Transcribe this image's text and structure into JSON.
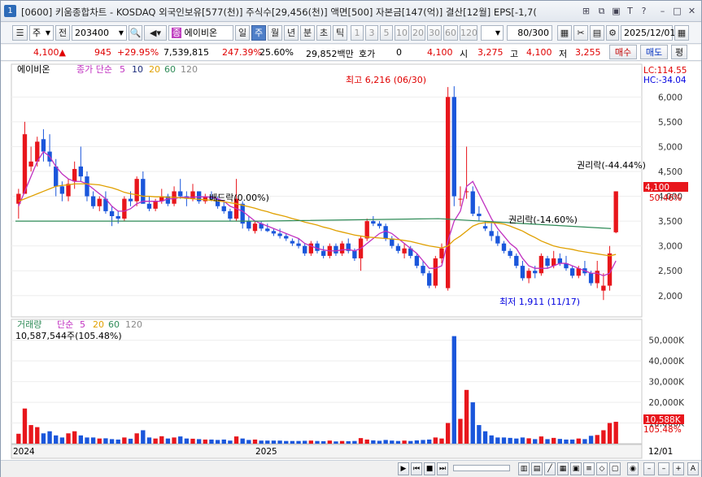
{
  "window": {
    "number": "1",
    "title": "[0600] 키움종합차트 - KOSDAQ 외국인보유[577(천)] 주식수[29,456(천)] 액면[500] 자본금[147(억)] 결산[12월] EPS[-1,7("
  },
  "toolbar": {
    "type_select": "주",
    "prev_label": "전",
    "code": "203400",
    "name_badge": "종",
    "stock_name": "에이비온",
    "periods": [
      "일",
      "주",
      "월",
      "년",
      "분",
      "초",
      "틱"
    ],
    "selected_period": "주",
    "numbers": [
      "1",
      "3",
      "5",
      "10",
      "20",
      "30",
      "60",
      "120"
    ],
    "count": "80/300",
    "date": "2025/12/01"
  },
  "quote": {
    "price": "4,100",
    "change": "945",
    "change_pct": "+29.95%",
    "volume": "7,539,815",
    "vol_ratio": "247.39%",
    "turnover": "25.60%",
    "amount": "29,852백만",
    "hoga_label": "호가",
    "hoga_value": "0",
    "hoga_price": "4,100",
    "open_label": "시",
    "open": "3,275",
    "high_label": "고",
    "high": "4,100",
    "low_label": "저",
    "low": "3,255",
    "sell": "매수",
    "buy": "매도",
    "flat": "평"
  },
  "price_panel": {
    "legend_name": "에이비온",
    "legend_ma_label": "종가 단순",
    "ma_periods": [
      "5",
      "10",
      "20",
      "60",
      "120"
    ],
    "lc": "LC:114.55",
    "hc": "HC:-34.04",
    "current_price": "4,100",
    "current_pct": "50.46%",
    "annotations": {
      "high": "최고 6,216 (06/30)",
      "low": "최저 1,911 (11/17)",
      "dividend": "배드락(0.00%)",
      "rights1": "권리락(-14.60%)",
      "rights2": "권리락(-44.44%)"
    }
  },
  "volume_panel": {
    "legend_name": "거래량",
    "legend_ma_label": "단순",
    "ma_periods": [
      "5",
      "20",
      "60",
      "120"
    ],
    "last_volume": "10,587,544주(105.48%)",
    "current_volume": "10,588K",
    "current_pct": "105.48%"
  },
  "x_labels": [
    "2024",
    "2025",
    "12/01"
  ],
  "colors": {
    "up": "#e8161c",
    "down": "#1a56db",
    "ma5": "#c030c0",
    "ma10": "#1a2a7a",
    "ma20": "#e0a000",
    "ma60": "#2e8b57",
    "ma120": "#888888"
  },
  "icons": [
    "search-icon",
    "speaker-icon",
    "grid-icon",
    "cross-icon",
    "save-icon",
    "gear-icon",
    "calendar-icon",
    "help-icon",
    "close-icon"
  ],
  "chart_data": {
    "type": "candlestick",
    "price_axis": {
      "min": 1800,
      "max": 6300,
      "ticks": [
        2000,
        2500,
        3000,
        3500,
        4000,
        4500,
        5000,
        5500,
        6000
      ]
    },
    "volume_axis": {
      "min": 0,
      "max": 55000,
      "ticks": [
        10000,
        20000,
        30000,
        40000,
        50000
      ],
      "unit": "K"
    },
    "candles": [
      [
        3850,
        4150,
        3550,
        4050,
        4800
      ],
      [
        4050,
        5500,
        4050,
        5250,
        17000
      ],
      [
        4600,
        5000,
        4500,
        4700,
        9000
      ],
      [
        4700,
        5200,
        4600,
        5100,
        8000
      ],
      [
        5150,
        5350,
        4700,
        4900,
        5000
      ],
      [
        4900,
        5250,
        4600,
        4700,
        6000
      ],
      [
        4600,
        4750,
        4000,
        4200,
        4000
      ],
      [
        4200,
        4300,
        3900,
        4050,
        3000
      ],
      [
        4000,
        4350,
        3900,
        4250,
        5000
      ],
      [
        4300,
        4700,
        4150,
        4550,
        6000
      ],
      [
        4600,
        5000,
        4300,
        4400,
        4000
      ],
      [
        4400,
        4500,
        3900,
        4000,
        3000
      ],
      [
        4000,
        4100,
        3750,
        3800,
        3000
      ],
      [
        3800,
        4000,
        3700,
        3950,
        2500
      ],
      [
        3950,
        4100,
        3650,
        3700,
        2600
      ],
      [
        3700,
        3800,
        3400,
        3600,
        2200
      ],
      [
        3600,
        3700,
        3450,
        3550,
        2000
      ],
      [
        3550,
        4000,
        3500,
        3950,
        3000
      ],
      [
        3950,
        4100,
        3800,
        3900,
        2400
      ],
      [
        3900,
        4400,
        3800,
        4350,
        5000
      ],
      [
        4350,
        4500,
        3850,
        3850,
        6500
      ],
      [
        3850,
        4000,
        3700,
        3750,
        3000
      ],
      [
        3750,
        3950,
        3700,
        3900,
        2500
      ],
      [
        3900,
        4150,
        3850,
        4000,
        3600
      ],
      [
        4000,
        4050,
        3800,
        3850,
        2500
      ],
      [
        3850,
        4200,
        3800,
        4100,
        3000
      ],
      [
        4100,
        4350,
        3950,
        4000,
        3500
      ],
      [
        4000,
        4100,
        3800,
        3950,
        2500
      ],
      [
        3950,
        4250,
        3900,
        4100,
        2400
      ],
      [
        4100,
        4100,
        3850,
        3900,
        2200
      ],
      [
        3900,
        4050,
        3850,
        4000,
        2000
      ],
      [
        4000,
        4100,
        3900,
        3950,
        2000
      ],
      [
        3950,
        4000,
        3750,
        3800,
        1800
      ],
      [
        3800,
        3900,
        3650,
        3700,
        2000
      ],
      [
        3700,
        3750,
        3500,
        3550,
        1500
      ],
      [
        3550,
        4350,
        3500,
        3950,
        3500
      ],
      [
        3850,
        3900,
        3350,
        3450,
        2500
      ],
      [
        3500,
        3600,
        3300,
        3350,
        1800
      ],
      [
        3300,
        3500,
        3250,
        3450,
        2000
      ],
      [
        3450,
        3500,
        3300,
        3350,
        1500
      ],
      [
        3350,
        3450,
        3280,
        3300,
        1500
      ],
      [
        3300,
        3350,
        3200,
        3250,
        1500
      ],
      [
        3250,
        3350,
        3150,
        3200,
        1500
      ],
      [
        3200,
        3250,
        3100,
        3150,
        1300
      ],
      [
        3100,
        3150,
        3000,
        3050,
        1300
      ],
      [
        3050,
        3150,
        2950,
        3000,
        1300
      ],
      [
        3000,
        3050,
        2800,
        2850,
        1400
      ],
      [
        2850,
        3100,
        2800,
        3050,
        1500
      ],
      [
        3050,
        3100,
        2850,
        2900,
        1300
      ],
      [
        2900,
        3000,
        2750,
        2800,
        1200
      ],
      [
        2800,
        3050,
        2750,
        3000,
        1500
      ],
      [
        3000,
        3050,
        2800,
        2850,
        1100
      ],
      [
        2850,
        3100,
        2800,
        3050,
        1300
      ],
      [
        3050,
        3150,
        2850,
        2900,
        1200
      ],
      [
        2900,
        2950,
        2700,
        2750,
        1300
      ],
      [
        2750,
        3200,
        2500,
        3150,
        2700
      ],
      [
        3150,
        3550,
        3100,
        3500,
        2000
      ],
      [
        3500,
        3600,
        3400,
        3450,
        1600
      ],
      [
        3450,
        3500,
        3350,
        3400,
        1400
      ],
      [
        3400,
        3450,
        3100,
        3150,
        1800
      ],
      [
        3150,
        3200,
        2950,
        3000,
        1500
      ],
      [
        3000,
        3050,
        2850,
        2900,
        1300
      ],
      [
        2850,
        3050,
        2750,
        2950,
        1500
      ],
      [
        2950,
        3000,
        2750,
        2800,
        1300
      ],
      [
        2800,
        2850,
        2550,
        2600,
        1600
      ],
      [
        2600,
        2700,
        2400,
        2450,
        1800
      ],
      [
        2450,
        2500,
        2150,
        2200,
        2000
      ],
      [
        2200,
        2800,
        2150,
        2750,
        3000
      ],
      [
        2750,
        3050,
        2650,
        2950,
        2500
      ],
      [
        2150,
        6200,
        2100,
        6000,
        10000
      ],
      [
        6000,
        6216,
        3800,
        4000,
        52000
      ],
      [
        3950,
        4200,
        3800,
        3950,
        12000
      ],
      [
        4100,
        5000,
        3950,
        4100,
        26000
      ],
      [
        4100,
        4200,
        3600,
        3650,
        20000
      ],
      [
        3650,
        3800,
        3500,
        3600,
        9000
      ],
      [
        3400,
        3500,
        3300,
        3350,
        6000
      ],
      [
        3300,
        3500,
        3100,
        3200,
        4000
      ],
      [
        3200,
        3300,
        3000,
        3050,
        3000
      ],
      [
        3050,
        3100,
        2850,
        2900,
        3000
      ],
      [
        2900,
        2950,
        2750,
        2800,
        2800
      ],
      [
        2800,
        2850,
        2550,
        2600,
        2500
      ],
      [
        2600,
        2700,
        2300,
        2350,
        3000
      ],
      [
        2350,
        2550,
        2250,
        2500,
        2600
      ],
      [
        2500,
        2600,
        2350,
        2450,
        2200
      ],
      [
        2450,
        2850,
        2400,
        2800,
        3500
      ],
      [
        2750,
        2800,
        2550,
        2600,
        2200
      ],
      [
        2600,
        2900,
        2550,
        2750,
        2800
      ],
      [
        2750,
        2850,
        2600,
        2650,
        2300
      ],
      [
        2650,
        2800,
        2500,
        2550,
        2000
      ],
      [
        2550,
        2600,
        2350,
        2400,
        2000
      ],
      [
        2400,
        2600,
        2350,
        2550,
        2500
      ],
      [
        2550,
        2700,
        2400,
        2450,
        2200
      ],
      [
        2450,
        2500,
        2200,
        2250,
        3800
      ],
      [
        2250,
        2700,
        2150,
        2500,
        4200
      ],
      [
        2100,
        2450,
        1911,
        2200,
        6500
      ],
      [
        2200,
        3000,
        2100,
        2850,
        10000
      ],
      [
        3275,
        4100,
        3255,
        4100,
        10588
      ]
    ],
    "ma_lines": {
      "ma5": [
        3800,
        4100,
        4400,
        4700,
        4900,
        4800,
        4600,
        4450,
        4350,
        4300,
        4300,
        4250,
        4150,
        4050,
        3950,
        3800,
        3700,
        3700,
        3750,
        3850,
        3900,
        3900,
        3900,
        3900,
        3950,
        3950,
        3980,
        3980,
        3980,
        3990,
        3990,
        3980,
        3950,
        3900,
        3800,
        3750,
        3700,
        3600,
        3500,
        3450,
        3400,
        3350,
        3300,
        3250,
        3200,
        3150,
        3050,
        3000,
        2950,
        2920,
        2900,
        2900,
        2920,
        2930,
        2900,
        2950,
        3050,
        3150,
        3250,
        3300,
        3250,
        3150,
        3050,
        2950,
        2850,
        2700,
        2550,
        2550,
        2600,
        3100,
        3500,
        3700,
        4200,
        4300,
        4050,
        3800,
        3550,
        3350,
        3200,
        3050,
        2950,
        2750,
        2600,
        2550,
        2550,
        2550,
        2600,
        2650,
        2650,
        2600,
        2550,
        2500,
        2450,
        2450,
        2400,
        2450,
        2700
      ],
      "ma20": [
        3900,
        3950,
        4000,
        4050,
        4100,
        4150,
        4200,
        4220,
        4230,
        4250,
        4250,
        4250,
        4240,
        4230,
        4200,
        4170,
        4130,
        4080,
        4050,
        4030,
        4000,
        4000,
        3990,
        3990,
        3980,
        3980,
        3970,
        3960,
        3950,
        3940,
        3930,
        3920,
        3910,
        3890,
        3870,
        3850,
        3820,
        3790,
        3760,
        3720,
        3690,
        3650,
        3620,
        3590,
        3550,
        3520,
        3480,
        3450,
        3420,
        3380,
        3350,
        3310,
        3280,
        3250,
        3220,
        3200,
        3180,
        3170,
        3160,
        3150,
        3140,
        3130,
        3110,
        3090,
        3060,
        3030,
        3000,
        2980,
        2960,
        3000,
        3120,
        3200,
        3300,
        3400,
        3450,
        3470,
        3470,
        3460,
        3440,
        3400,
        3350,
        3300,
        3230,
        3170,
        3100,
        3050,
        3000,
        2970,
        2950,
        2930,
        2900,
        2880,
        2860,
        2840,
        2820,
        2800,
        2830
      ]
    }
  }
}
